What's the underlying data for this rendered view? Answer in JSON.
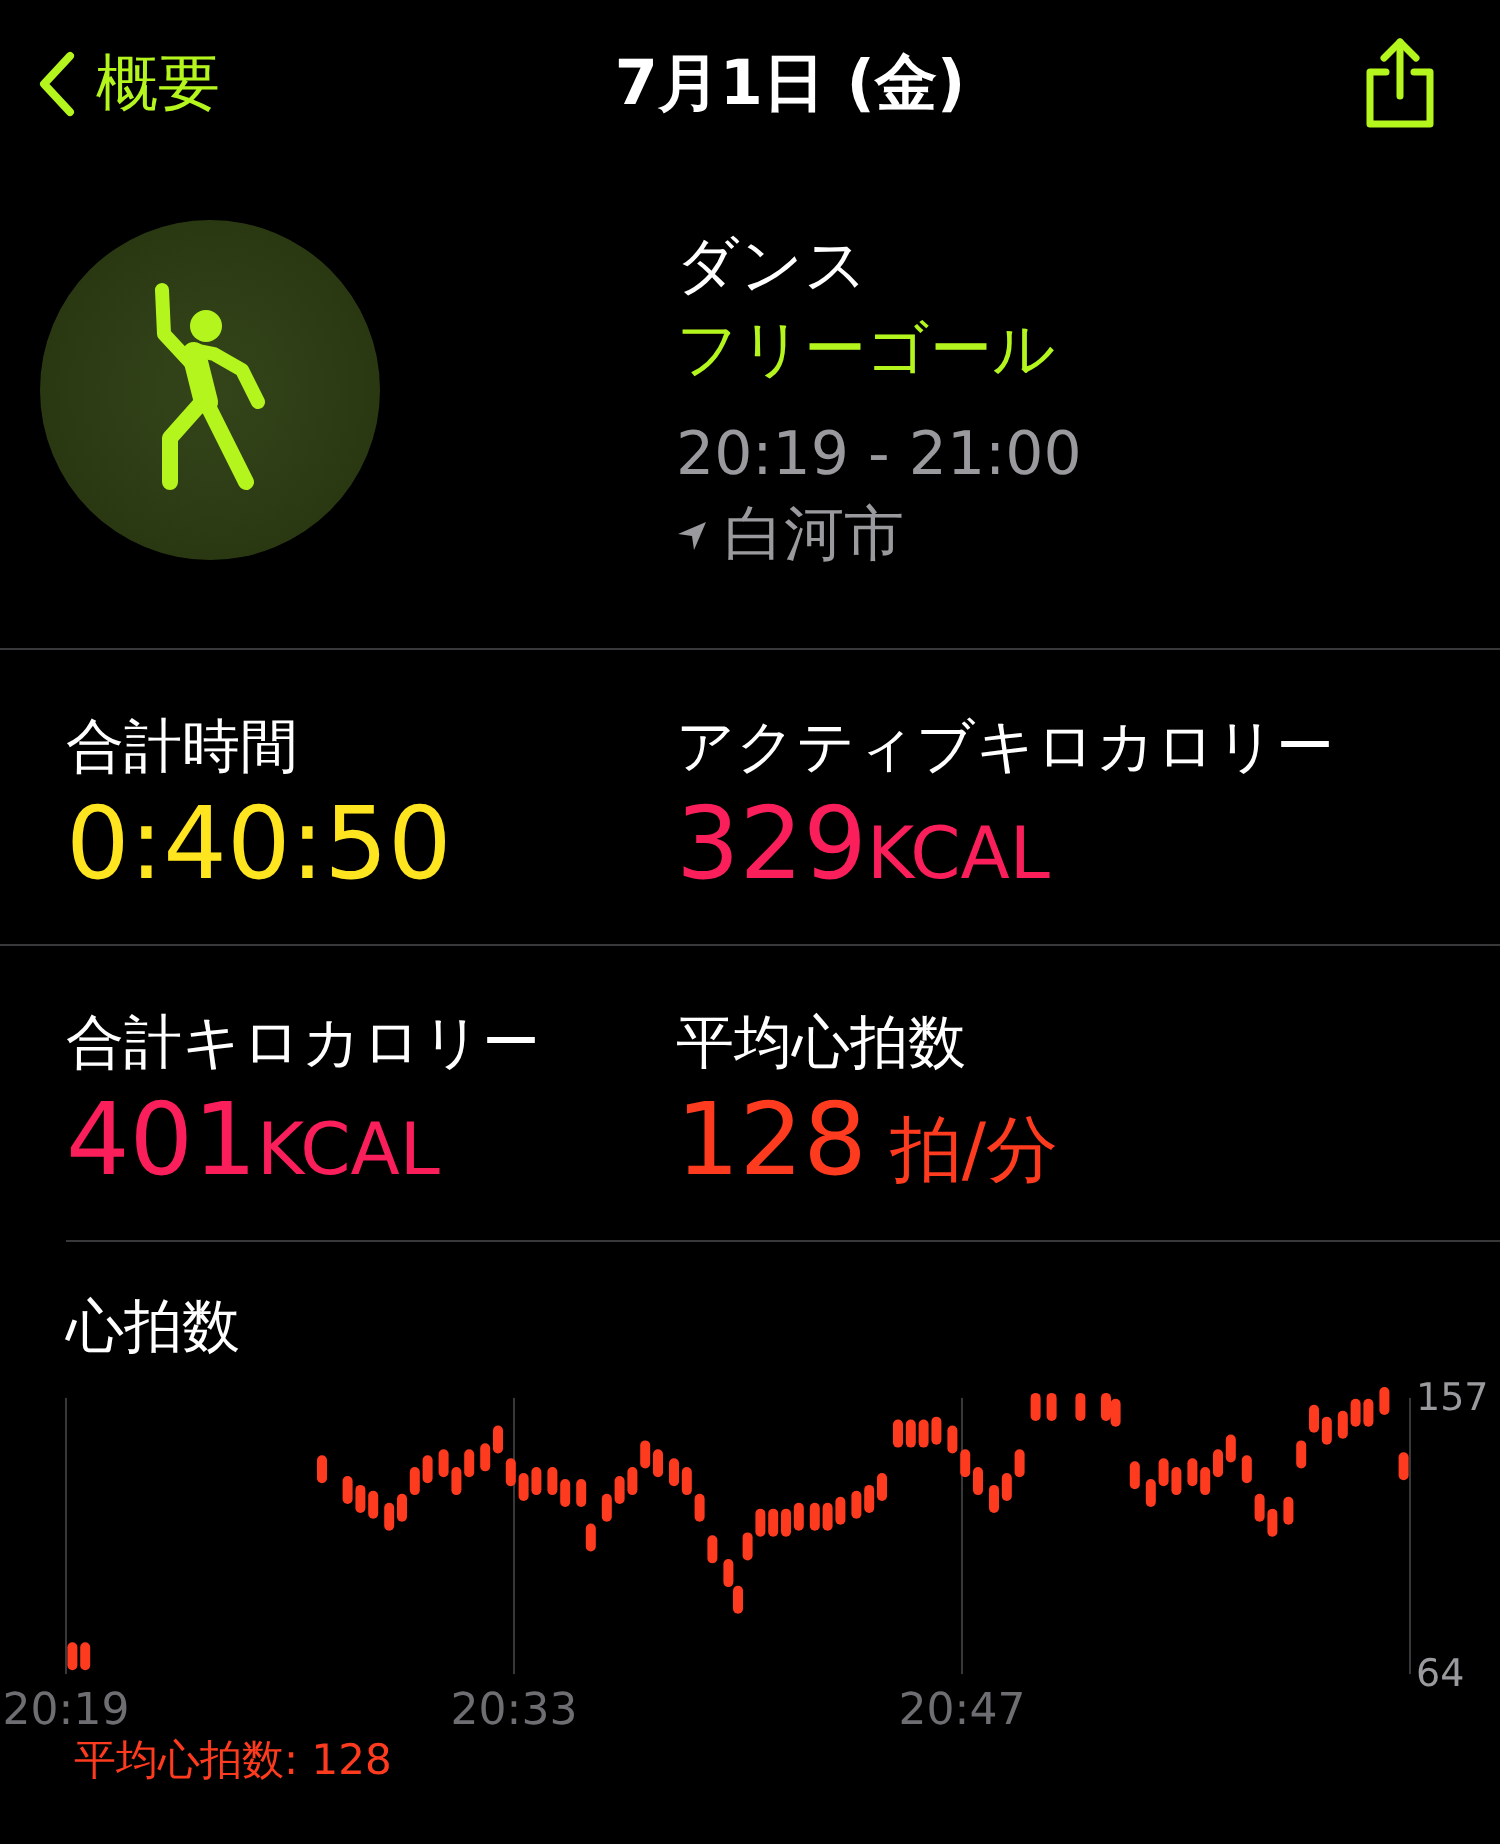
{
  "nav": {
    "back": "概要",
    "title": "7月1日 (金)"
  },
  "workout": {
    "name": "ダンス",
    "goal": "フリーゴール",
    "time": "20:19 - 21:00",
    "location": "白河市"
  },
  "stats": [
    {
      "label": "合計時間",
      "value": "0:40:50",
      "color": "#ffe51f"
    },
    {
      "label": "アクティブキロカロリー",
      "value": "329",
      "unit": "KCAL",
      "color": "#fa1f5a"
    },
    {
      "label": "合計キロカロリー",
      "value": "401",
      "unit": "KCAL",
      "color": "#fa1f5a"
    },
    {
      "label": "平均心拍数",
      "value": "128",
      "unit": "拍/分",
      "color": "#ff3b1f"
    }
  ],
  "heart_rate": {
    "title": "心拍数",
    "average": "平均心拍数: 128",
    "chart_data": {
      "type": "scatter",
      "ylim": [
        64,
        157
      ],
      "yticks": [
        64,
        157
      ],
      "xlim": [
        1219,
        1261
      ],
      "xticks": [
        {
          "value": 1219,
          "label": "20:19"
        },
        {
          "value": 1233,
          "label": "20:33"
        },
        {
          "value": 1247,
          "label": "20:47"
        }
      ],
      "x": [
        1219.2,
        1219.6,
        1227.0,
        1227.8,
        1228.2,
        1228.6,
        1229.1,
        1229.5,
        1229.9,
        1230.3,
        1230.8,
        1231.2,
        1231.6,
        1232.1,
        1232.5,
        1232.9,
        1233.3,
        1233.7,
        1234.2,
        1234.6,
        1235.1,
        1235.4,
        1235.9,
        1236.3,
        1236.7,
        1237.1,
        1237.5,
        1238.0,
        1238.4,
        1238.8,
        1239.2,
        1239.7,
        1240.0,
        1240.3,
        1240.7,
        1241.1,
        1241.5,
        1241.9,
        1242.4,
        1242.8,
        1243.2,
        1243.7,
        1244.1,
        1244.5,
        1245.0,
        1245.4,
        1245.8,
        1246.2,
        1246.7,
        1247.1,
        1247.5,
        1248.0,
        1248.4,
        1248.8,
        1249.3,
        1249.8,
        1250.7,
        1251.5,
        1251.8,
        1252.4,
        1252.9,
        1253.3,
        1253.7,
        1254.2,
        1254.6,
        1255.0,
        1255.4,
        1255.9,
        1256.3,
        1256.7,
        1257.2,
        1257.6,
        1258.0,
        1258.4,
        1258.9,
        1259.3,
        1259.7,
        1260.2,
        1260.8
      ],
      "series": [
        {
          "color": "#ff3b1f",
          "values": [
            70,
            70,
            133,
            126,
            123,
            121,
            117,
            120,
            129,
            133,
            135,
            129,
            135,
            137,
            143,
            132,
            127,
            129,
            129,
            125,
            125,
            110,
            120,
            126,
            129,
            138,
            135,
            132,
            129,
            120,
            106,
            98,
            89,
            107,
            115,
            115,
            115,
            117,
            117,
            117,
            119,
            121,
            123,
            127,
            145,
            145,
            145,
            146,
            143,
            135,
            129,
            123,
            127,
            135,
            154,
            154,
            154,
            154,
            152,
            131,
            125,
            132,
            129,
            132,
            129,
            135,
            140,
            133,
            120,
            115,
            119,
            138,
            150,
            146,
            148,
            152,
            152,
            156,
            134
          ]
        }
      ]
    }
  }
}
